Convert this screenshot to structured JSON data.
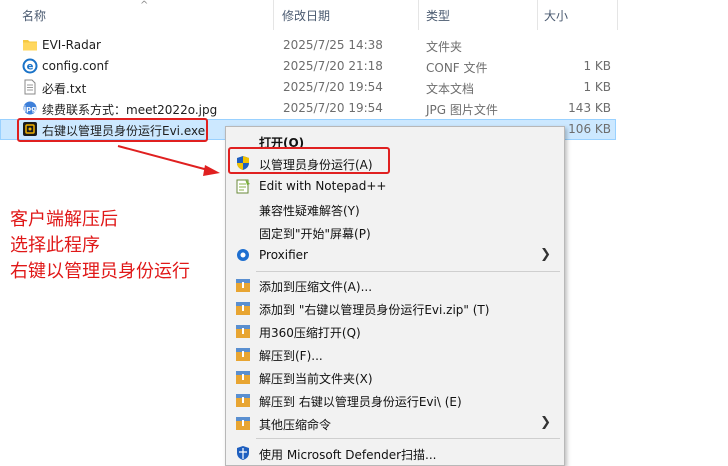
{
  "columns": {
    "name": "名称",
    "date": "修改日期",
    "type": "类型",
    "size": "大小"
  },
  "files": [
    {
      "name": "EVI-Radar",
      "date": "2025/7/25 14:38",
      "type": "文件夹",
      "size": "",
      "icon": "folder-icon"
    },
    {
      "name": "config.conf",
      "date": "2025/7/20 21:18",
      "type": "CONF 文件",
      "size": "1 KB",
      "icon": "ie-file-icon"
    },
    {
      "name": "必看.txt",
      "date": "2025/7/20 19:54",
      "type": "文本文档",
      "size": "1 KB",
      "icon": "text-file-icon"
    },
    {
      "name": "续费联系方式：meet2022o.jpg",
      "date": "2025/7/20 19:54",
      "type": "JPG 图片文件",
      "size": "143 KB",
      "icon": "image-file-icon"
    },
    {
      "name": "右键以管理员身份运行Evi.exe",
      "date": "",
      "type": "",
      "size": "106 KB",
      "icon": "exe-app-icon"
    }
  ],
  "annotation": {
    "line1": "客户端解压后",
    "line2": "选择此程序",
    "line3": "右键以管理员身份运行"
  },
  "menu": {
    "open": "打开(O)",
    "run_as_admin": "以管理员身份运行(A)",
    "edit_notepad": "Edit with Notepad++",
    "compat": "兼容性疑难解答(Y)",
    "pin_start": "固定到\"开始\"屏幕(P)",
    "proxifier": "Proxifier",
    "add_archive": "添加到压缩文件(A)...",
    "add_zip": "添加到 \"右键以管理员身份运行Evi.zip\" (T)",
    "open_360": "用360压缩打开(Q)",
    "extract_to": "解压到(F)...",
    "extract_here": "解压到当前文件夹(X)",
    "extract_folder": "解压到 右键以管理员身份运行Evi\\ (E)",
    "more_compress": "其他压缩命令",
    "defender": "使用 Microsoft Defender扫描..."
  },
  "colors": {
    "highlight_red": "#e02020",
    "selection_bg": "#cce8ff",
    "menu_bg": "#f2f2f2"
  }
}
